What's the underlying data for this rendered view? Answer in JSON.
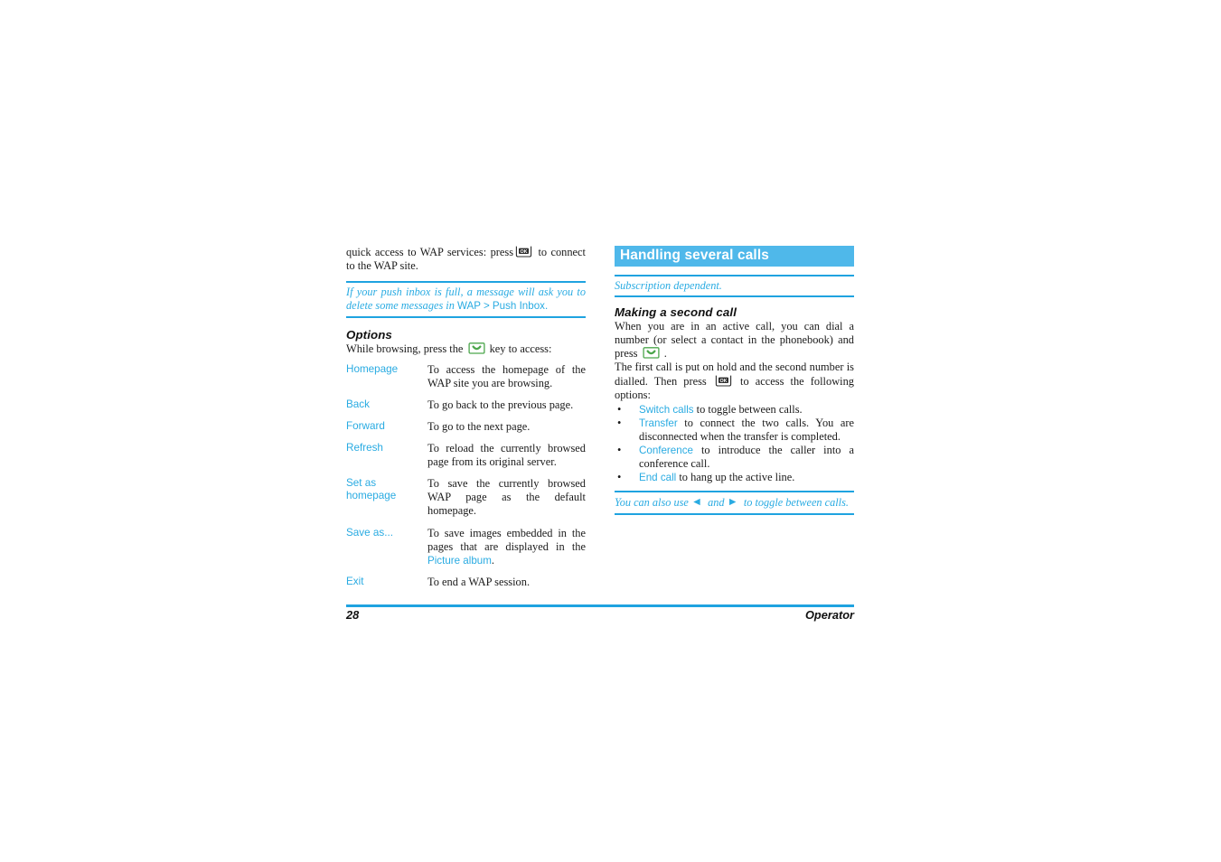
{
  "document": {
    "page_number": "28",
    "footer_label": "Operator"
  },
  "left_column": {
    "intro_before_key": "quick access to WAP services: press",
    "intro_after_key": "to connect to the WAP site.",
    "note": {
      "part1": "If your push inbox is full, a message will ask you to delete some messages in ",
      "part2": "WAP > Push Inbox.",
      "color": "#29ABE2"
    },
    "options_heading": "Options",
    "options_intro_before_key": "While browsing, press the",
    "options_intro_after_key": "key to access:",
    "options": [
      {
        "term": "Homepage",
        "desc": "To access the homepage of the WAP site you are browsing."
      },
      {
        "term": "Back",
        "desc": "To go back to the previous page."
      },
      {
        "term": "Forward",
        "desc": "To go to the next page."
      },
      {
        "term": "Refresh",
        "desc": "To reload the currently browsed page from its original server."
      },
      {
        "term": "Set as homepage",
        "desc": "To save the currently browsed WAP page as the default homepage."
      },
      {
        "term": "Save as...",
        "desc_before_link": "To save images embedded in the pages that are displayed in the ",
        "desc_link": "Picture album",
        "desc_after_link": "."
      },
      {
        "term": "Exit",
        "desc": "To end a WAP session."
      }
    ]
  },
  "right_column": {
    "section_title": "Handling several calls",
    "section_title_bg": "#4FB8EA",
    "note": "Subscription dependent.",
    "sub_heading": "Making a second call",
    "paragraph_1_before_key": "When you are in an active call, you can dial a number (or select a contact in the phonebook) and press",
    "paragraph_1_after_key": ".",
    "paragraph_2_before_key": "The first call is put on hold and the second number is dialled. Then press",
    "paragraph_2_after_key": "to access the following options:",
    "bullets": [
      {
        "marker": "•",
        "link": "Switch calls",
        "text": " to toggle between calls."
      },
      {
        "marker": "•",
        "link": "Transfer",
        "text": " to connect the two calls. You are disconnected when the transfer is completed."
      },
      {
        "marker": "•",
        "link": "Conference",
        "text": " to introduce the caller into a conference call."
      },
      {
        "marker": "•",
        "link": "End call",
        "text": " to hang up the active line."
      }
    ],
    "bottom_note": {
      "part1": "You can also use",
      "part2": "and",
      "part3": "to toggle between calls."
    }
  },
  "icons": {
    "ok_key_label": "OK",
    "ok_key_color": "#2b2b2b",
    "soft_key_color": "#4CA64C",
    "left_arrow": "◄",
    "right_arrow": "►"
  }
}
